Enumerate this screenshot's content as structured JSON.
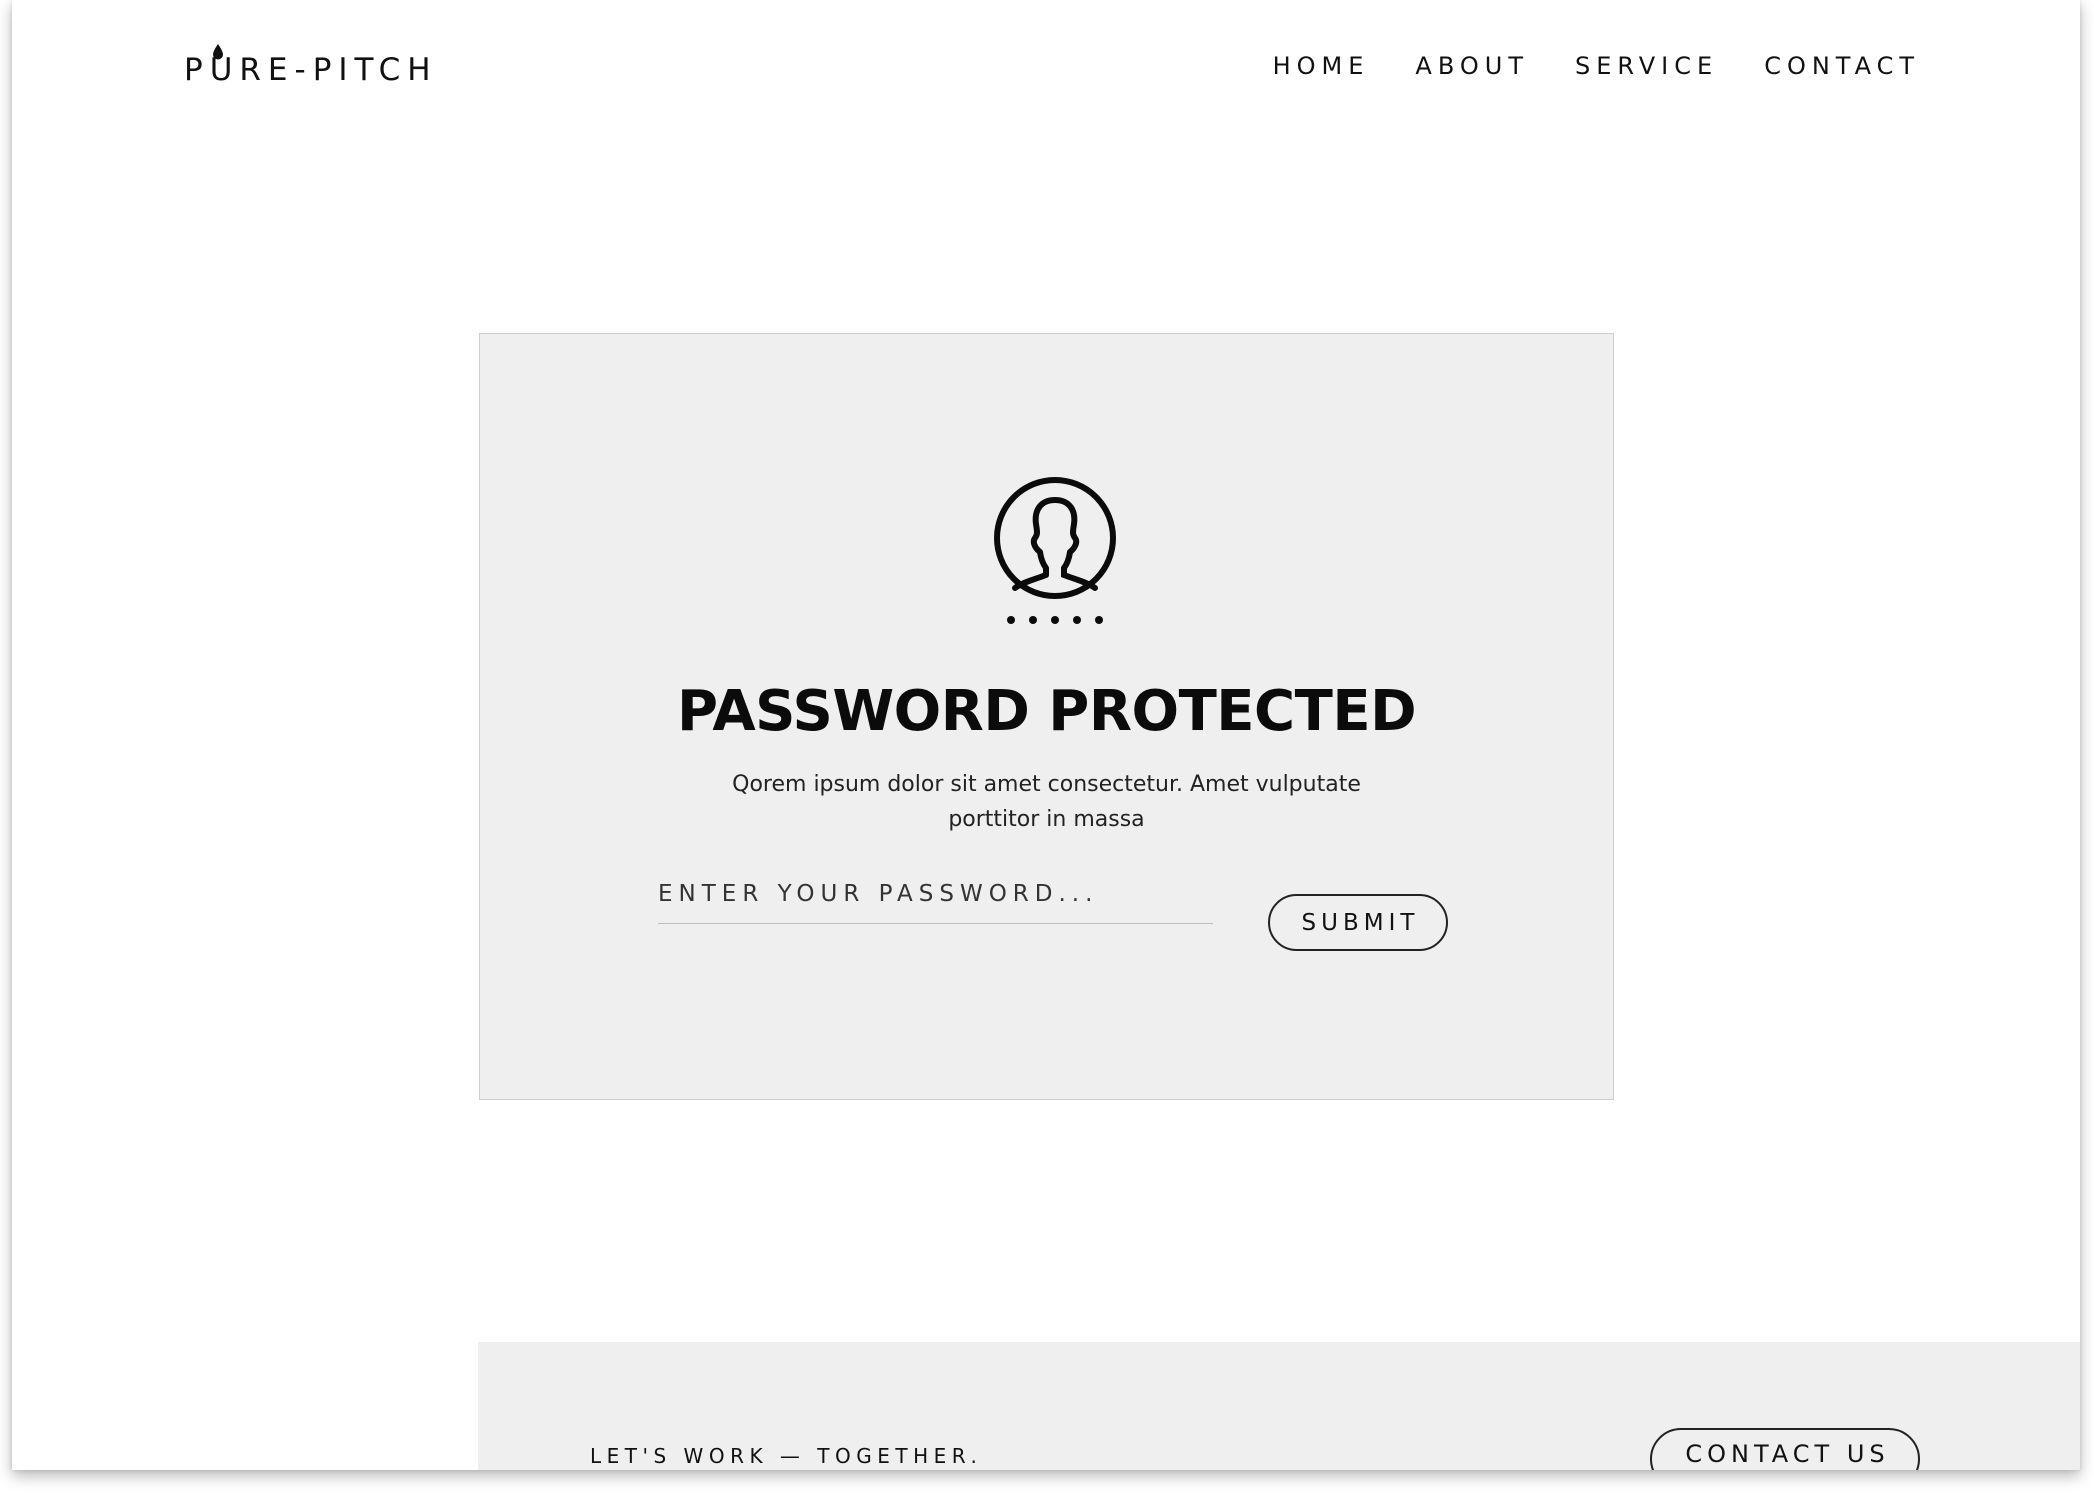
{
  "header": {
    "logo_text": "PURE-PITCH",
    "nav": [
      {
        "label": "HOME"
      },
      {
        "label": "ABOUT"
      },
      {
        "label": "SERVICE"
      },
      {
        "label": "CONTACT"
      }
    ]
  },
  "card": {
    "title": "PASSWORD PROTECTED",
    "description": "Qorem ipsum dolor sit amet consectetur. Amet vulputate porttitor in massa",
    "password_placeholder": "ENTER YOUR PASSWORD...",
    "submit_label": "SUBMIT",
    "icon": "user-lock-icon"
  },
  "footer": {
    "tagline": "LET'S WORK — TOGETHER.",
    "contact_button": "CONTACT US"
  }
}
